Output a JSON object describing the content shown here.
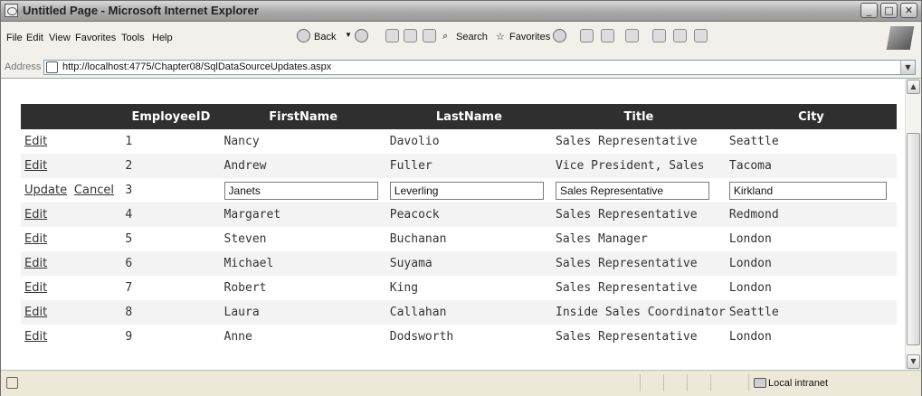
{
  "window": {
    "title": "Untitled Page - Microsoft Internet Explorer",
    "minimize": "_",
    "maximize": "□",
    "close": "✕"
  },
  "menu": [
    "File",
    "Edit",
    "View",
    "Favorites",
    "Tools",
    "Help"
  ],
  "toolbar": {
    "back_label": "Back",
    "search_label": "Search",
    "favorites_label": "Favorites"
  },
  "address": {
    "label": "Address",
    "url": "http://localhost:4775/Chapter08/SqlDataSourceUpdates.aspx"
  },
  "grid": {
    "headers": [
      "",
      "EmployeeID",
      "FirstName",
      "LastName",
      "Title",
      "City"
    ],
    "edit_label": "Edit",
    "update_label": "Update",
    "cancel_label": "Cancel",
    "rows": [
      {
        "id": "1",
        "first": "Nancy",
        "last": "Davolio",
        "title": "Sales Representative",
        "city": "Seattle"
      },
      {
        "id": "2",
        "first": "Andrew",
        "last": "Fuller",
        "title": "Vice President, Sales",
        "city": "Tacoma"
      },
      {
        "id": "3",
        "first": "Janets",
        "last": "Leverling",
        "title": "Sales Representative",
        "city": "Kirkland",
        "editing": true
      },
      {
        "id": "4",
        "first": "Margaret",
        "last": "Peacock",
        "title": "Sales Representative",
        "city": "Redmond"
      },
      {
        "id": "5",
        "first": "Steven",
        "last": "Buchanan",
        "title": "Sales Manager",
        "city": "London"
      },
      {
        "id": "6",
        "first": "Michael",
        "last": "Suyama",
        "title": "Sales Representative",
        "city": "London"
      },
      {
        "id": "7",
        "first": "Robert",
        "last": "King",
        "title": "Sales Representative",
        "city": "London"
      },
      {
        "id": "8",
        "first": "Laura",
        "last": "Callahan",
        "title": "Inside Sales Coordinator",
        "city": "Seattle"
      },
      {
        "id": "9",
        "first": "Anne",
        "last": "Dodsworth",
        "title": "Sales Representative",
        "city": "London"
      }
    ]
  },
  "status": {
    "zone": "Local intranet"
  },
  "colors": {
    "header_bg": "#2f2f2f",
    "header_fg": "#ffffff",
    "alt_row": "#f3f3f3"
  }
}
